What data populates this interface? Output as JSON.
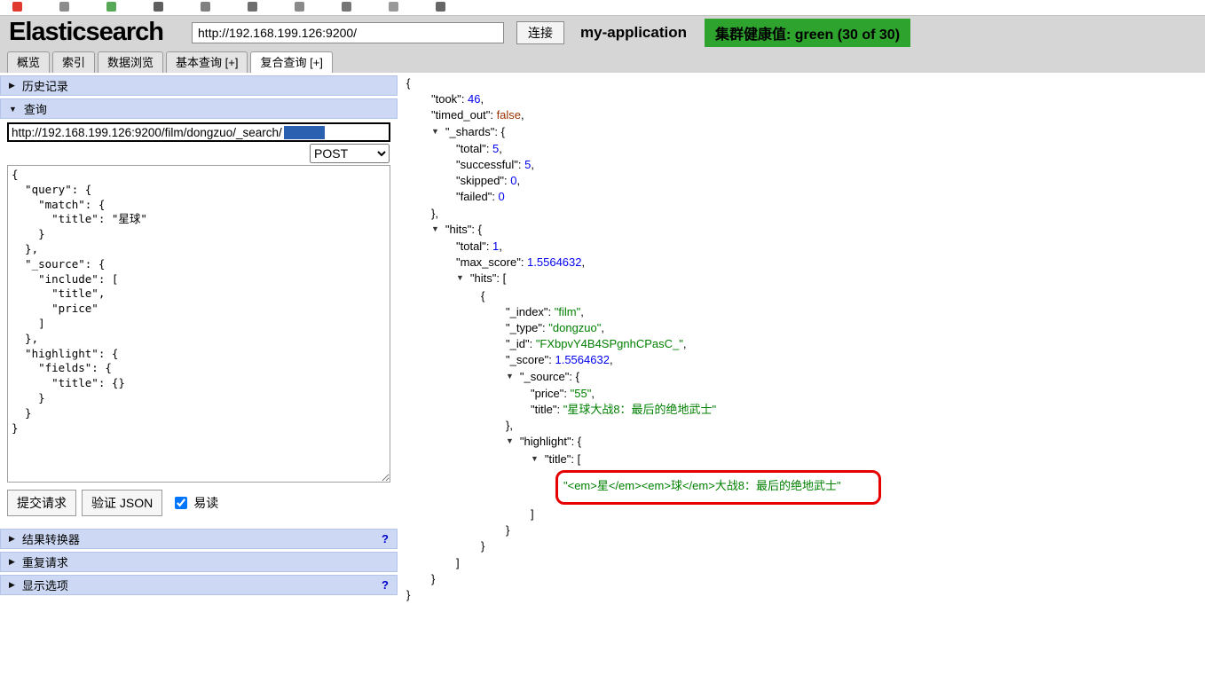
{
  "browser": {
    "favicons": [
      "#e03a2f",
      "#8c8c8c",
      "#57a957",
      "#5f5f5f",
      "#808080",
      "#6e6e6e",
      "#8a8a8a",
      "#757575",
      "#999999",
      "#666666"
    ]
  },
  "header": {
    "app_title": "Elasticsearch",
    "url_value": "http://192.168.199.126:9200/",
    "connect_label": "连接",
    "cluster_name": "my-application",
    "health_label": "集群健康值: green (30 of 30)",
    "health_color": "#2ea32e"
  },
  "tabs": [
    {
      "name": "tab-overview",
      "label": "概览",
      "active": false
    },
    {
      "name": "tab-indices",
      "label": "索引",
      "active": false
    },
    {
      "name": "tab-data-browser",
      "label": "数据浏览",
      "active": false
    },
    {
      "name": "tab-basic-query",
      "label": "基本查询 [+]",
      "active": false
    },
    {
      "name": "tab-compound-query",
      "label": "复合查询 [+]",
      "active": true
    }
  ],
  "sidebar": {
    "history_header": "历史记录",
    "query_header": "查询",
    "request_url": "http://192.168.199.126:9200/film/dongzuo/_search/",
    "selection_color": "#2b5fb0",
    "method_options": [
      "POST"
    ],
    "method_selected": "POST",
    "request_body": "{\n  \"query\": {\n    \"match\": {\n      \"title\": \"星球\"\n    }\n  },\n  \"_source\": {\n    \"include\": [\n      \"title\",\n      \"price\"\n    ]\n  },\n  \"highlight\": {\n    \"fields\": {\n      \"title\": {}\n    }\n  }\n}",
    "submit_label": "提交请求",
    "validate_label": "验证 JSON",
    "readable_label": "易读",
    "readable_checked": true,
    "sections": [
      {
        "name": "section-result-transformer",
        "label": "结果转换器",
        "help": "?"
      },
      {
        "name": "section-repeat-request",
        "label": "重复请求",
        "help": ""
      },
      {
        "name": "section-display-options",
        "label": "显示选项",
        "help": "?"
      }
    ]
  },
  "result": {
    "colors": {
      "number": "#0000ee",
      "string": "#008000",
      "boolean": "#993300",
      "key": "#000000",
      "box": "#e60000"
    },
    "lines": [
      {
        "i": 0,
        "t": false,
        "x": [
          [
            "p",
            "{"
          ]
        ]
      },
      {
        "i": 1,
        "t": false,
        "x": [
          [
            "k",
            "\"took\""
          ],
          [
            "p",
            ": "
          ],
          [
            "n",
            "46"
          ],
          [
            "p",
            ","
          ]
        ]
      },
      {
        "i": 1,
        "t": false,
        "x": [
          [
            "k",
            "\"timed_out\""
          ],
          [
            "p",
            ": "
          ],
          [
            "b",
            "false"
          ],
          [
            "p",
            ","
          ]
        ]
      },
      {
        "i": 1,
        "t": true,
        "x": [
          [
            "k",
            "\"_shards\""
          ],
          [
            "p",
            ": {"
          ]
        ]
      },
      {
        "i": 2,
        "t": false,
        "x": [
          [
            "k",
            "\"total\""
          ],
          [
            "p",
            ": "
          ],
          [
            "n",
            "5"
          ],
          [
            "p",
            ","
          ]
        ]
      },
      {
        "i": 2,
        "t": false,
        "x": [
          [
            "k",
            "\"successful\""
          ],
          [
            "p",
            ": "
          ],
          [
            "n",
            "5"
          ],
          [
            "p",
            ","
          ]
        ]
      },
      {
        "i": 2,
        "t": false,
        "x": [
          [
            "k",
            "\"skipped\""
          ],
          [
            "p",
            ": "
          ],
          [
            "n",
            "0"
          ],
          [
            "p",
            ","
          ]
        ]
      },
      {
        "i": 2,
        "t": false,
        "x": [
          [
            "k",
            "\"failed\""
          ],
          [
            "p",
            ": "
          ],
          [
            "n",
            "0"
          ]
        ]
      },
      {
        "i": 1,
        "t": false,
        "x": [
          [
            "p",
            "},"
          ]
        ]
      },
      {
        "i": 1,
        "t": true,
        "x": [
          [
            "k",
            "\"hits\""
          ],
          [
            "p",
            ": {"
          ]
        ]
      },
      {
        "i": 2,
        "t": false,
        "x": [
          [
            "k",
            "\"total\""
          ],
          [
            "p",
            ": "
          ],
          [
            "n",
            "1"
          ],
          [
            "p",
            ","
          ]
        ]
      },
      {
        "i": 2,
        "t": false,
        "x": [
          [
            "k",
            "\"max_score\""
          ],
          [
            "p",
            ": "
          ],
          [
            "n",
            "1.5564632"
          ],
          [
            "p",
            ","
          ]
        ]
      },
      {
        "i": 2,
        "t": true,
        "x": [
          [
            "k",
            "\"hits\""
          ],
          [
            "p",
            ": ["
          ]
        ]
      },
      {
        "i": 3,
        "t": false,
        "x": [
          [
            "p",
            "{"
          ]
        ]
      },
      {
        "i": 4,
        "t": false,
        "x": [
          [
            "k",
            "\"_index\""
          ],
          [
            "p",
            ": "
          ],
          [
            "s",
            "\"film\""
          ],
          [
            "p",
            ","
          ]
        ]
      },
      {
        "i": 4,
        "t": false,
        "x": [
          [
            "k",
            "\"_type\""
          ],
          [
            "p",
            ": "
          ],
          [
            "s",
            "\"dongzuo\""
          ],
          [
            "p",
            ","
          ]
        ]
      },
      {
        "i": 4,
        "t": false,
        "x": [
          [
            "k",
            "\"_id\""
          ],
          [
            "p",
            ": "
          ],
          [
            "s",
            "\"FXbpvY4B4SPgnhCPasC_\""
          ],
          [
            "p",
            ","
          ]
        ]
      },
      {
        "i": 4,
        "t": false,
        "x": [
          [
            "k",
            "\"_score\""
          ],
          [
            "p",
            ": "
          ],
          [
            "n",
            "1.5564632"
          ],
          [
            "p",
            ","
          ]
        ]
      },
      {
        "i": 4,
        "t": true,
        "x": [
          [
            "k",
            "\"_source\""
          ],
          [
            "p",
            ": {"
          ]
        ]
      },
      {
        "i": 5,
        "t": false,
        "x": [
          [
            "k",
            "\"price\""
          ],
          [
            "p",
            ": "
          ],
          [
            "s",
            "\"55\""
          ],
          [
            "p",
            ","
          ]
        ]
      },
      {
        "i": 5,
        "t": false,
        "x": [
          [
            "k",
            "\"title\""
          ],
          [
            "p",
            ": "
          ],
          [
            "s",
            "\"星球大战8：最后的绝地武士\""
          ]
        ]
      },
      {
        "i": 4,
        "t": false,
        "x": [
          [
            "p",
            "},"
          ]
        ]
      },
      {
        "i": 4,
        "t": true,
        "x": [
          [
            "k",
            "\"highlight\""
          ],
          [
            "p",
            ": {"
          ]
        ]
      },
      {
        "i": 5,
        "t": true,
        "x": [
          [
            "k",
            "\"title\""
          ],
          [
            "p",
            ": ["
          ]
        ]
      },
      {
        "i": 6,
        "t": false,
        "box": true,
        "x": [
          [
            "s",
            "\"<em>星</em><em>球</em>大战8：最后的绝地武士\""
          ]
        ]
      },
      {
        "i": 5,
        "t": false,
        "x": [
          [
            "p",
            "]"
          ]
        ]
      },
      {
        "i": 4,
        "t": false,
        "x": [
          [
            "p",
            "}"
          ]
        ]
      },
      {
        "i": 3,
        "t": false,
        "x": [
          [
            "p",
            "}"
          ]
        ]
      },
      {
        "i": 2,
        "t": false,
        "x": [
          [
            "p",
            "]"
          ]
        ]
      },
      {
        "i": 1,
        "t": false,
        "x": [
          [
            "p",
            "}"
          ]
        ]
      },
      {
        "i": 0,
        "t": false,
        "x": [
          [
            "p",
            "}"
          ]
        ]
      }
    ]
  }
}
